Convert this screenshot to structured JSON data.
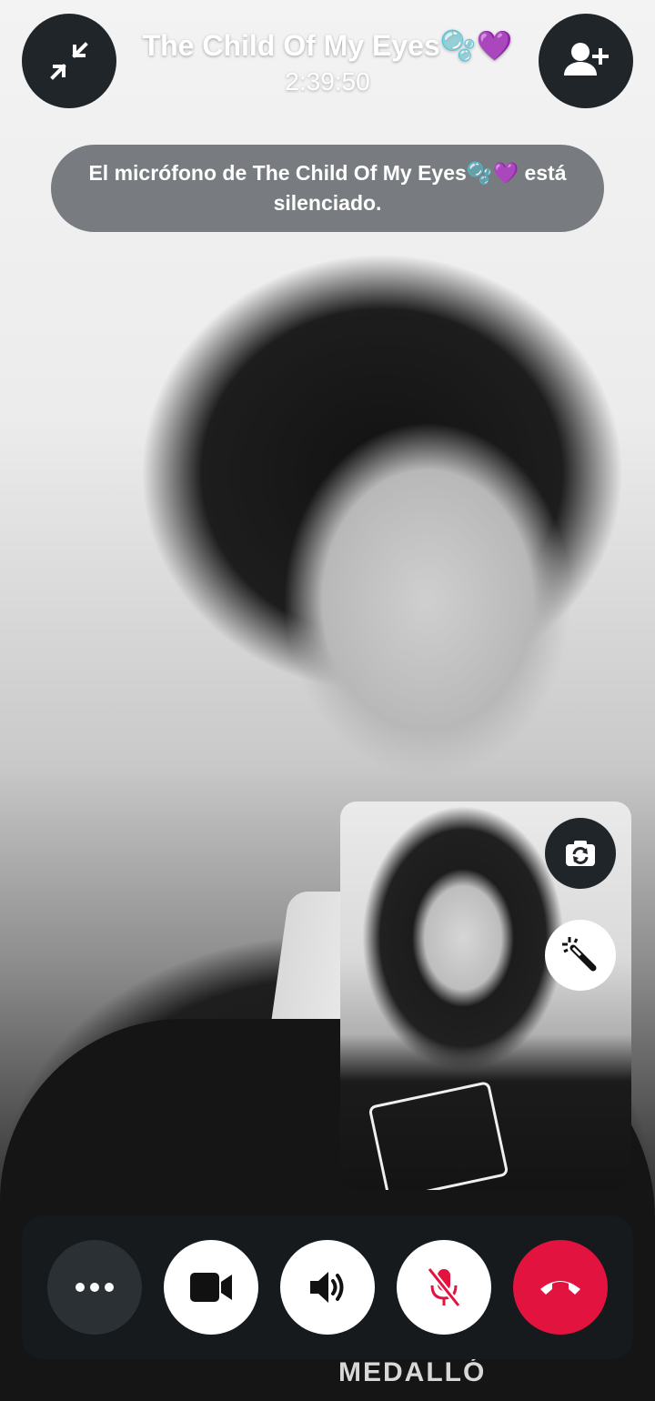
{
  "call": {
    "contact_name": "The Child Of My Eyes🫧💜",
    "timer": "2:39:50"
  },
  "notification": {
    "text": "El micrófono de The Child Of My Eyes🫧💜 está silenciado."
  },
  "background": {
    "jacket_text": "MEDALLÓ"
  },
  "colors": {
    "end_call": "#e2133e",
    "dark_button": "#1f2529",
    "control_bar": "#161a1d"
  },
  "icons": {
    "minimize": "minimize-icon",
    "add_person": "add-person-icon",
    "flip_camera": "flip-camera-icon",
    "effects": "magic-wand-icon",
    "more": "more-icon",
    "video": "video-camera-icon",
    "speaker": "speaker-icon",
    "mute": "microphone-muted-icon",
    "end_call": "end-call-icon"
  }
}
